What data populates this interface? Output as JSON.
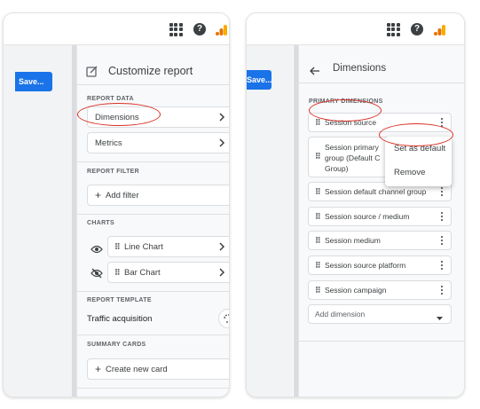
{
  "left": {
    "save_label": "Save...",
    "panel_title": "Customize report",
    "sections": {
      "report_data": "REPORT DATA",
      "report_filter": "REPORT FILTER",
      "charts": "CHARTS",
      "report_template": "REPORT TEMPLATE",
      "summary_cards": "SUMMARY CARDS"
    },
    "dimensions_label": "Dimensions",
    "metrics_label": "Metrics",
    "add_filter_label": "Add filter",
    "charts": [
      {
        "label": "Line Chart",
        "visibility_icon": "eye-icon"
      },
      {
        "label": "Bar Chart",
        "visibility_icon": "eye-off-icon"
      }
    ],
    "template_name": "Traffic acquisition",
    "create_card_label": "Create new card"
  },
  "right": {
    "save_label": "Save...",
    "panel_title": "Dimensions",
    "section_label": "PRIMARY DIMENSIONS",
    "dimensions": [
      "Session source",
      "Session primary channel group (Default Channel Group)",
      "Session default channel group",
      "Session source / medium",
      "Session medium",
      "Session source platform",
      "Session campaign"
    ],
    "dimension_two_lines": [
      "Session primary",
      "group (Default C",
      "Group)"
    ],
    "add_dimension_label": "Add dimension",
    "menu": {
      "set_default": "Set as default",
      "remove": "Remove"
    }
  },
  "colors": {
    "accent_blue": "#1a73e8",
    "highlight_red": "#d93025",
    "ga_orange": "#f9ab00",
    "ga_dark_orange": "#e37400"
  }
}
